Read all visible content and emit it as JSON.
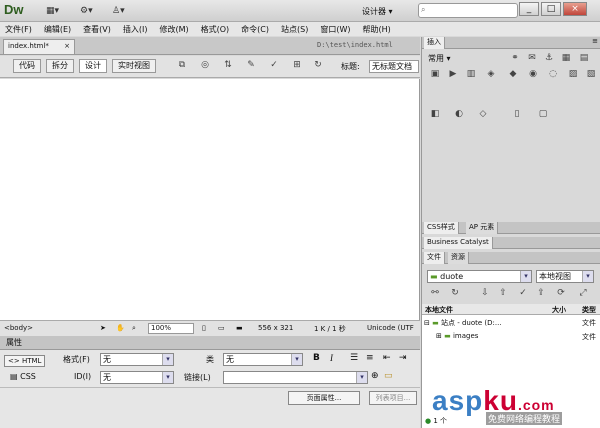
{
  "app": {
    "logo": "Dw",
    "workspace": "设计器",
    "search_placeholder": ""
  },
  "window_buttons": [
    "_",
    "□",
    "×"
  ],
  "menu": [
    "文件(F)",
    "编辑(E)",
    "查看(V)",
    "插入(I)",
    "修改(M)",
    "格式(O)",
    "命令(C)",
    "站点(S)",
    "窗口(W)",
    "帮助(H)"
  ],
  "doc_tab": {
    "name": "index.html*",
    "path": "D:\\test\\index.html"
  },
  "doc_toolbar": {
    "views": [
      "代码",
      "拆分",
      "设计",
      "实时视图"
    ],
    "active_view": "设计",
    "title_label": "标题:",
    "title_value": "无标题文档"
  },
  "status": {
    "tag": "<body>",
    "zoom": "100%",
    "size": "556 x 321",
    "filesize": "1 K / 1 秒",
    "encoding": "Unicode (UTF"
  },
  "properties": {
    "header": "属性",
    "html_btn": "HTML",
    "css_btn": "CSS",
    "format_label": "格式(F)",
    "format_value": "无",
    "class_label": "类",
    "class_value": "无",
    "id_label": "ID(I)",
    "id_value": "无",
    "link_label": "链接(L)",
    "page_props_btn": "页面属性...",
    "list_item_btn": "列表项目..."
  },
  "insert_panel": {
    "tab": "插入",
    "category": "常用"
  },
  "css_panel_tabs": [
    "CSS样式",
    "AP 元素"
  ],
  "bc_panel": "Business Catalyst",
  "files_panel": {
    "tabs": [
      "文件",
      "资源"
    ],
    "site": "duote",
    "view": "本地视图",
    "columns": [
      "本地文件",
      "大小",
      "类型"
    ],
    "rows": [
      {
        "name": "站点 - duote (D:...",
        "type": "文件"
      },
      {
        "name": "images",
        "type": "文件"
      }
    ],
    "footer": "1 个"
  },
  "watermark": {
    "text_a": "asp",
    "text_b": "ku",
    "text_c": ".com",
    "sub": "免费网络编程教程"
  }
}
